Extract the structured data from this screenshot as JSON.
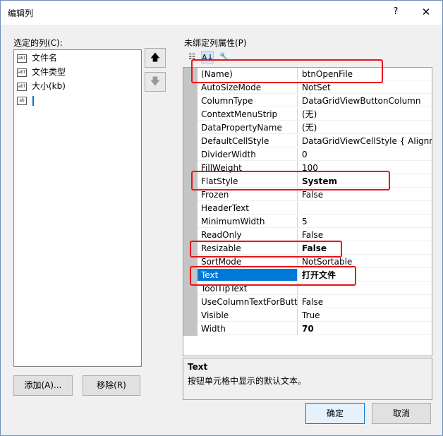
{
  "window": {
    "title": "编辑列",
    "help": "?",
    "close": "✕"
  },
  "left": {
    "label": "选定的列(C):",
    "items": [
      {
        "icon": "abl",
        "label": "文件名"
      },
      {
        "icon": "abl",
        "label": "文件类型"
      },
      {
        "icon": "abl",
        "label": "大小(kb)"
      },
      {
        "icon": "ab",
        "label": ""
      }
    ],
    "move_up": "🡅",
    "move_down": "🡇",
    "add_button": "添加(A)...",
    "remove_button": "移除(R)"
  },
  "right": {
    "label": "未绑定列属性(P)",
    "toolbar": {
      "categorized": "☷",
      "alphabetical": "A↓",
      "wrench": "🔧"
    },
    "properties": [
      {
        "name": "(Name)",
        "value": "btnOpenFile",
        "bold": false
      },
      {
        "name": "AutoSizeMode",
        "value": "NotSet",
        "bold": false
      },
      {
        "name": "ColumnType",
        "value": "DataGridViewButtonColumn",
        "bold": false
      },
      {
        "name": "ContextMenuStrip",
        "value": "(无)",
        "bold": false
      },
      {
        "name": "DataPropertyName",
        "value": "(无)",
        "bold": false
      },
      {
        "name": "DefaultCellStyle",
        "value": "DataGridViewCellStyle { Alignme",
        "bold": false
      },
      {
        "name": "DividerWidth",
        "value": "0",
        "bold": false
      },
      {
        "name": "FillWeight",
        "value": "100",
        "bold": false
      },
      {
        "name": "FlatStyle",
        "value": "System",
        "bold": true
      },
      {
        "name": "Frozen",
        "value": "False",
        "bold": false
      },
      {
        "name": "HeaderText",
        "value": "",
        "bold": false
      },
      {
        "name": "MinimumWidth",
        "value": "5",
        "bold": false
      },
      {
        "name": "ReadOnly",
        "value": "False",
        "bold": false
      },
      {
        "name": "Resizable",
        "value": "False",
        "bold": true
      },
      {
        "name": "SortMode",
        "value": "NotSortable",
        "bold": false
      },
      {
        "name": "Text",
        "value": "打开文件",
        "bold": true,
        "selected": true
      },
      {
        "name": "ToolTipText",
        "value": "",
        "bold": false
      },
      {
        "name": "UseColumnTextForButto",
        "value": "False",
        "bold": false
      },
      {
        "name": "Visible",
        "value": "True",
        "bold": false
      },
      {
        "name": "Width",
        "value": "70",
        "bold": true
      }
    ],
    "description": {
      "title": "Text",
      "text": "按钮单元格中显示的默认文本。"
    }
  },
  "footer": {
    "ok": "确定",
    "cancel": "取消"
  },
  "colors": {
    "highlight": "#e8141b",
    "selection": "#0078d7"
  }
}
